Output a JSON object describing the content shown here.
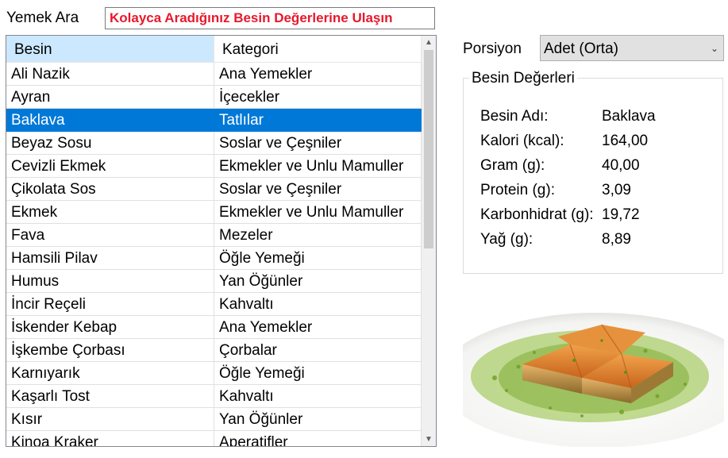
{
  "search": {
    "label": "Yemek Ara",
    "value": "Kolayca Aradığınız Besin Değerlerine Ulaşın",
    "text_color": "#e8182c"
  },
  "grid": {
    "columns": [
      "Besin",
      "Kategori"
    ],
    "selected_index": 2,
    "selection_color": "#0078d7",
    "rows": [
      {
        "name": "Ali Nazik",
        "category": "Ana Yemekler"
      },
      {
        "name": "Ayran",
        "category": "İçecekler"
      },
      {
        "name": "Baklava",
        "category": "Tatlılar"
      },
      {
        "name": "Beyaz Sosu",
        "category": "Soslar ve Çeşniler"
      },
      {
        "name": "Cevizli Ekmek",
        "category": "Ekmekler ve Unlu Mamuller"
      },
      {
        "name": "Çikolata Sos",
        "category": "Soslar ve Çeşniler"
      },
      {
        "name": "Ekmek",
        "category": "Ekmekler ve Unlu Mamuller"
      },
      {
        "name": "Fava",
        "category": "Mezeler"
      },
      {
        "name": "Hamsili Pilav",
        "category": "Öğle Yemeği"
      },
      {
        "name": "Humus",
        "category": "Yan Öğünler"
      },
      {
        "name": "İncir Reçeli",
        "category": "Kahvaltı"
      },
      {
        "name": "İskender Kebap",
        "category": "Ana Yemekler"
      },
      {
        "name": "İşkembe Çorbası",
        "category": "Çorbalar"
      },
      {
        "name": "Karnıyarık",
        "category": "Öğle Yemeği"
      },
      {
        "name": "Kaşarlı Tost",
        "category": "Kahvaltı"
      },
      {
        "name": "Kısır",
        "category": "Yan Öğünler"
      },
      {
        "name": "Kinoa Kraker",
        "category": "Aperatifler"
      }
    ]
  },
  "portion": {
    "label": "Porsiyon",
    "selected": "Adet (Orta)"
  },
  "nutrition": {
    "title": "Besin Değerleri",
    "items": [
      {
        "label": "Besin Adı:",
        "value": "Baklava"
      },
      {
        "label": "Kalori (kcal):",
        "value": "164,00"
      },
      {
        "label": "Gram (g):",
        "value": "40,00"
      },
      {
        "label": "Protein (g):",
        "value": "3,09"
      },
      {
        "label": "Karbonhidrat (g):",
        "value": "19,72"
      },
      {
        "label": "Yağ (g):",
        "value": "8,89"
      }
    ]
  },
  "image": {
    "subject": "baklava-with-pistachio"
  }
}
